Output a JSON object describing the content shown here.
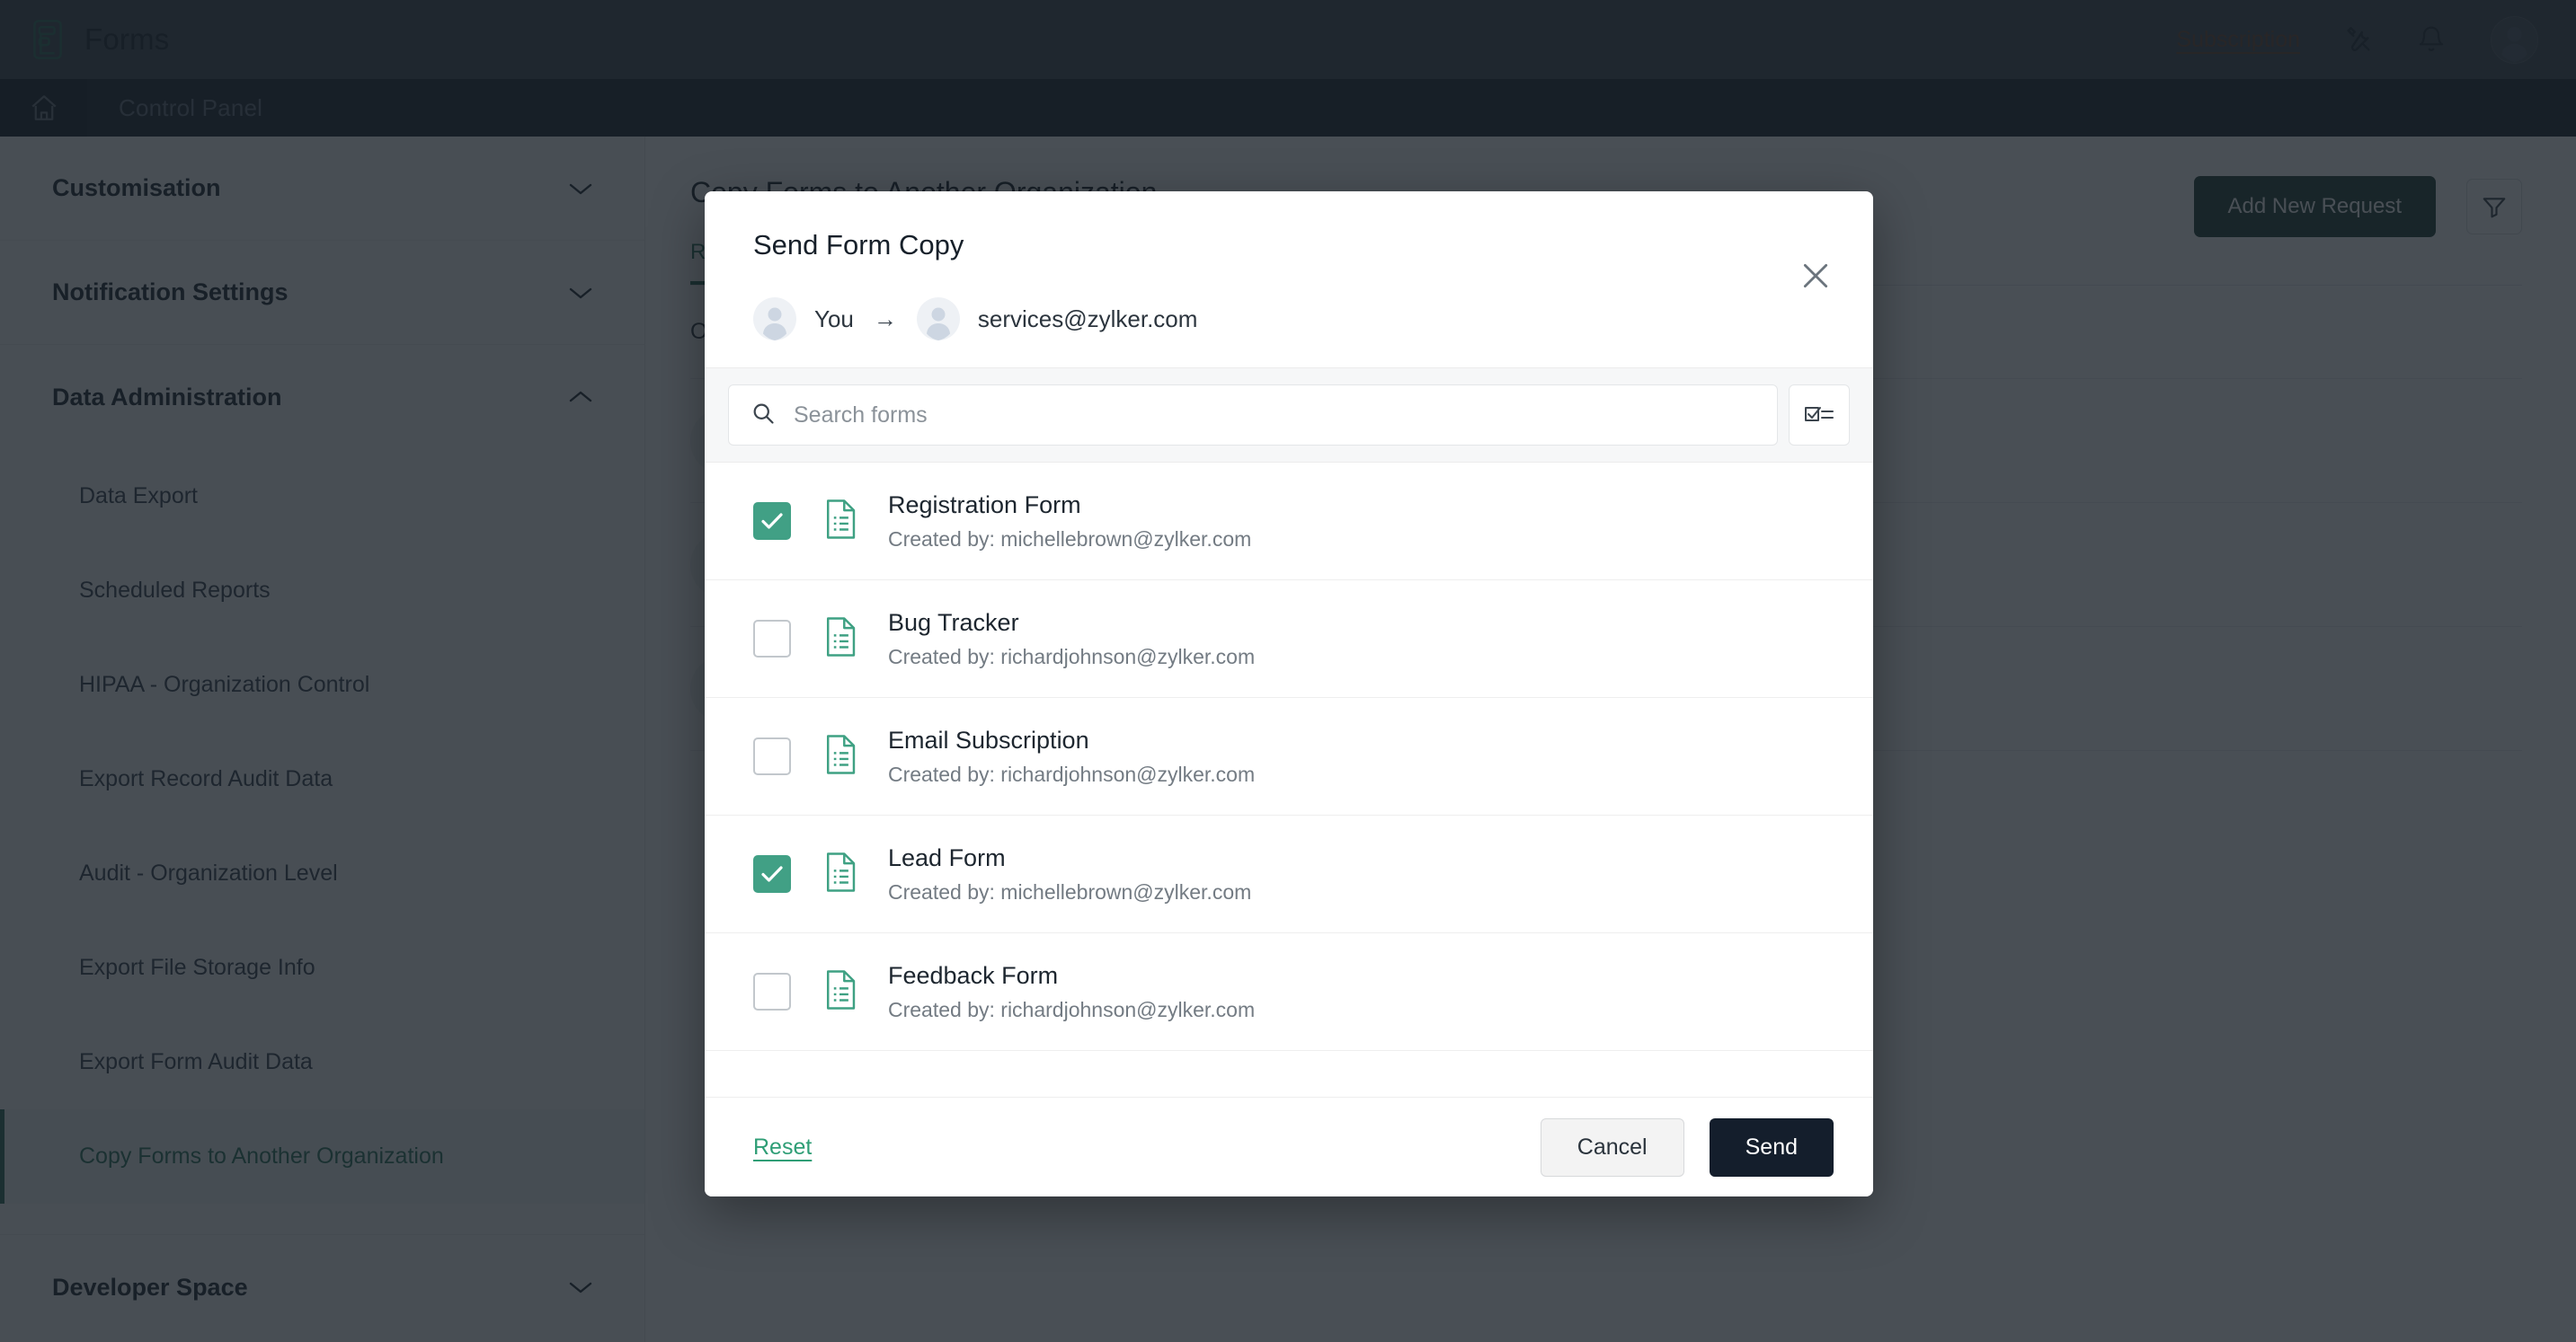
{
  "topbar": {
    "brand": "Forms",
    "logo_icon": "forms-logo-icon",
    "subscription_label": "Subscription",
    "tools_icon": "tools-icon",
    "bell_icon": "bell-icon",
    "avatar_icon": "user-avatar-icon",
    "bg": "#414a52"
  },
  "secondbar": {
    "home_icon": "home-icon",
    "title": "Control Panel",
    "bg": "#1f2731"
  },
  "sidebar": {
    "groups": [
      {
        "label": "Customisation",
        "expanded": false
      },
      {
        "label": "Notification Settings",
        "expanded": false
      },
      {
        "label": "Data Administration",
        "expanded": true
      },
      {
        "label": "Developer Space",
        "expanded": false
      }
    ],
    "data_admin_items": [
      {
        "label": "Data Export",
        "active": false
      },
      {
        "label": "Scheduled Reports",
        "active": false
      },
      {
        "label": "HIPAA - Organization Control",
        "active": false
      },
      {
        "label": "Export Record Audit Data",
        "active": false
      },
      {
        "label": "Audit - Organization Level",
        "active": false
      },
      {
        "label": "Export File Storage Info",
        "active": false
      },
      {
        "label": "Export Form Audit Data",
        "active": false
      },
      {
        "label": "Copy Forms to Another Organization",
        "active": true
      }
    ],
    "active_color": "#2f7561"
  },
  "main": {
    "page_title": "Copy Forms to Another Organization",
    "tabs": [
      {
        "label": "Requests",
        "active": true
      }
    ],
    "add_button": "Add New Request",
    "add_button_color": "#204039",
    "filter_icon": "funnel-filter-icon",
    "table_header": "Organization",
    "rows": [
      {
        "icon": "organization-building-icon"
      },
      {
        "icon": "user-person-icon"
      },
      {
        "icon": "organization-building-icon"
      }
    ]
  },
  "modal": {
    "title": "Send Form Copy",
    "close_icon": "close-icon",
    "sender": "You",
    "arrow": "→",
    "recipient": "services@zylker.com",
    "sender_avatar_icon": "user-avatar-icon",
    "recipient_avatar_icon": "user-avatar-icon",
    "search": {
      "placeholder": "Search forms",
      "value": "",
      "icon": "search-icon"
    },
    "select_all_icon": "checklist-select-all-icon",
    "forms": [
      {
        "name": "Registration Form",
        "created_by": "Created by: michellebrown@zylker.com",
        "checked": true,
        "icon": "form-document-icon"
      },
      {
        "name": "Bug Tracker",
        "created_by": "Created by: richardjohnson@zylker.com",
        "checked": false,
        "icon": "form-document-icon"
      },
      {
        "name": "Email Subscription",
        "created_by": "Created by: richardjohnson@zylker.com",
        "checked": false,
        "icon": "form-document-icon"
      },
      {
        "name": "Lead Form",
        "created_by": "Created by: michellebrown@zylker.com",
        "checked": true,
        "icon": "form-document-icon"
      },
      {
        "name": "Feedback Form",
        "created_by": "Created by: richardjohnson@zylker.com",
        "checked": false,
        "icon": "form-document-icon"
      }
    ],
    "footer": {
      "reset_label": "Reset",
      "cancel_label": "Cancel",
      "send_label": "Send"
    },
    "checked_color": "#41a085",
    "send_color": "#141e2c",
    "reset_color": "#2f9e76"
  }
}
